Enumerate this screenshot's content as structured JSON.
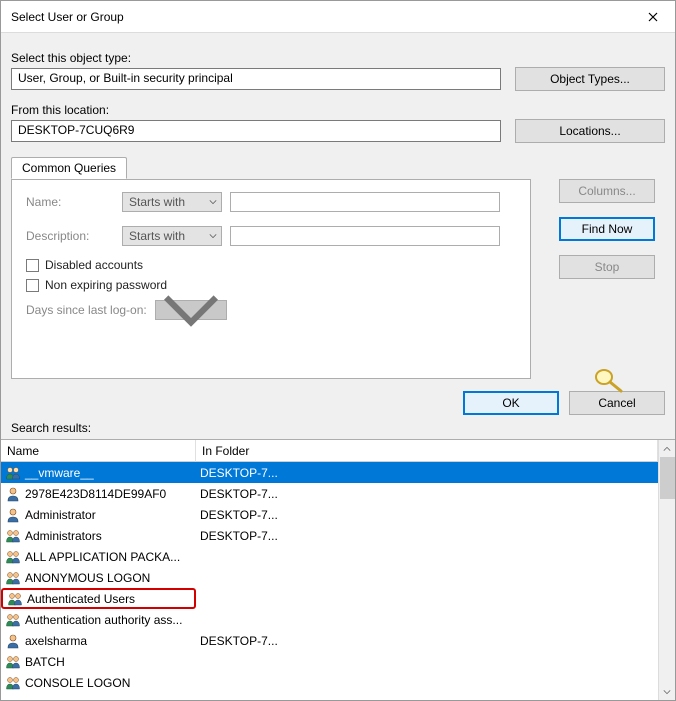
{
  "title": "Select User or Group",
  "labels": {
    "objectType": "Select this object type:",
    "fromLocation": "From this location:",
    "searchResults": "Search results:"
  },
  "fields": {
    "objectType": "User, Group, or Built-in security principal",
    "location": "DESKTOP-7CUQ6R9"
  },
  "buttons": {
    "objectTypes": "Object Types...",
    "locations": "Locations...",
    "columns": "Columns...",
    "findNow": "Find Now",
    "stop": "Stop",
    "ok": "OK",
    "cancel": "Cancel"
  },
  "tabs": {
    "commonQueries": "Common Queries"
  },
  "commonQueries": {
    "nameLabel": "Name:",
    "descLabel": "Description:",
    "startsWith": "Starts with",
    "disabled": "Disabled accounts",
    "nonExpiring": "Non expiring password",
    "daysSince": "Days since last log-on:"
  },
  "columns": {
    "name": "Name",
    "inFolder": "In Folder"
  },
  "results": [
    {
      "name": "__vmware__",
      "folder": "DESKTOP-7...",
      "iconType": "group",
      "selected": true
    },
    {
      "name": "2978E423D8114DE99AF0",
      "folder": "DESKTOP-7...",
      "iconType": "user"
    },
    {
      "name": "Administrator",
      "folder": "DESKTOP-7...",
      "iconType": "user"
    },
    {
      "name": "Administrators",
      "folder": "DESKTOP-7...",
      "iconType": "group"
    },
    {
      "name": "ALL APPLICATION PACKA...",
      "folder": "",
      "iconType": "group"
    },
    {
      "name": "ANONYMOUS LOGON",
      "folder": "",
      "iconType": "group"
    },
    {
      "name": "Authenticated Users",
      "folder": "",
      "iconType": "group",
      "highlighted": true
    },
    {
      "name": "Authentication authority ass...",
      "folder": "",
      "iconType": "group"
    },
    {
      "name": "axelsharma",
      "folder": "DESKTOP-7...",
      "iconType": "user"
    },
    {
      "name": "BATCH",
      "folder": "",
      "iconType": "group"
    },
    {
      "name": "CONSOLE LOGON",
      "folder": "",
      "iconType": "group"
    }
  ]
}
